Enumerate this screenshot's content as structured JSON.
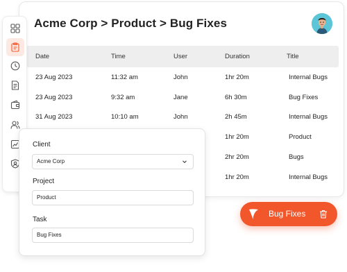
{
  "header": {
    "title": "Acme Corp > Product > Bug Fixes"
  },
  "table": {
    "columns": [
      "Date",
      "Time",
      "User",
      "Duration",
      "Title"
    ],
    "rows": [
      [
        "23 Aug 2023",
        "11:32 am",
        "John",
        "1hr 20m",
        "Internal Bugs"
      ],
      [
        "23 Aug 2023",
        "9:32 am",
        "Jane",
        "6h 30m",
        "Bug Fixes"
      ],
      [
        "31 Aug 2023",
        "10:10 am",
        "John",
        "2h 45m",
        "Internal Bugs"
      ],
      [
        "",
        "",
        "",
        "1hr 20m",
        "Product"
      ],
      [
        "",
        "",
        "",
        "2hr 20m",
        "Bugs"
      ],
      [
        "",
        "",
        "",
        "1hr 20m",
        "Internal Bugs"
      ]
    ]
  },
  "sidebar": {
    "items": [
      {
        "icon": "grid-icon",
        "active": false
      },
      {
        "icon": "clipboard-icon",
        "active": true
      },
      {
        "icon": "clock-icon",
        "active": false
      },
      {
        "icon": "document-icon",
        "active": false
      },
      {
        "icon": "wallet-icon",
        "active": false
      },
      {
        "icon": "users-icon",
        "active": false
      },
      {
        "icon": "chart-icon",
        "active": false
      },
      {
        "icon": "shield-user-icon",
        "active": false
      }
    ]
  },
  "form": {
    "client_label": "Client",
    "client_value": "Acme Corp",
    "project_label": "Project",
    "project_value": "Product",
    "task_label": "Task",
    "task_value": "Bug Fixes"
  },
  "timer": {
    "label": "Bug Fixes"
  },
  "colors": {
    "accent": "#f2572c",
    "active_bg": "#fde9e2",
    "icon": "#555555",
    "active_icon": "#f2572c"
  }
}
